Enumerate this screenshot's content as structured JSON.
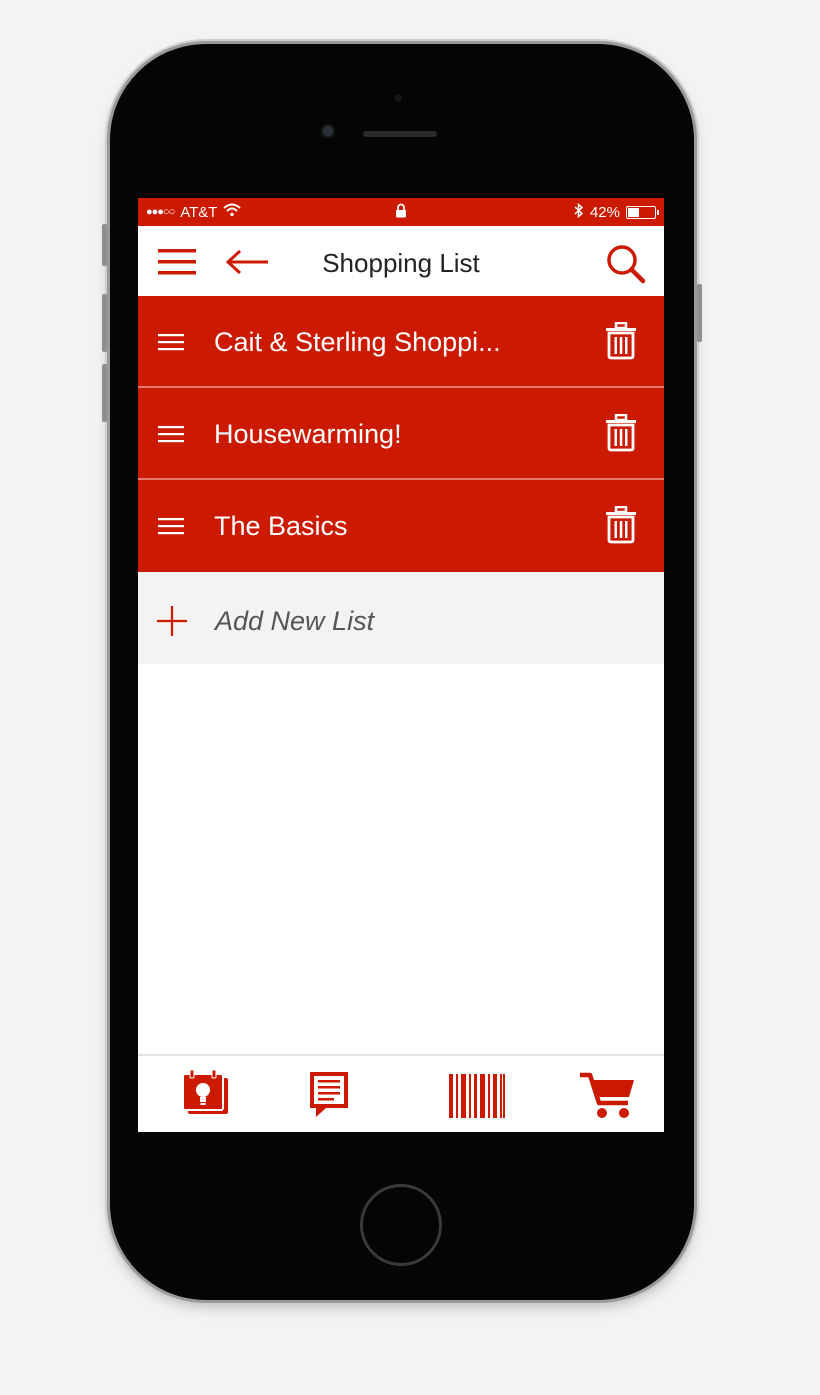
{
  "status_bar": {
    "carrier": "AT&T",
    "battery_percent": "42%",
    "battery_level": 0.42,
    "signal_bars": "●●●○○"
  },
  "nav": {
    "title": "Shopping List"
  },
  "lists": [
    {
      "name": "Cait & Sterling Shoppi..."
    },
    {
      "name": "Housewarming!"
    },
    {
      "name": "The Basics"
    }
  ],
  "add_new": {
    "label": "Add New List"
  },
  "tabs": [
    {
      "icon": "weekly-ad-icon"
    },
    {
      "icon": "list-icon"
    },
    {
      "icon": "barcode-icon"
    },
    {
      "icon": "cart-icon"
    }
  ],
  "colors": {
    "brand_red": "#cc1a00",
    "background": "#f3f3f4"
  }
}
